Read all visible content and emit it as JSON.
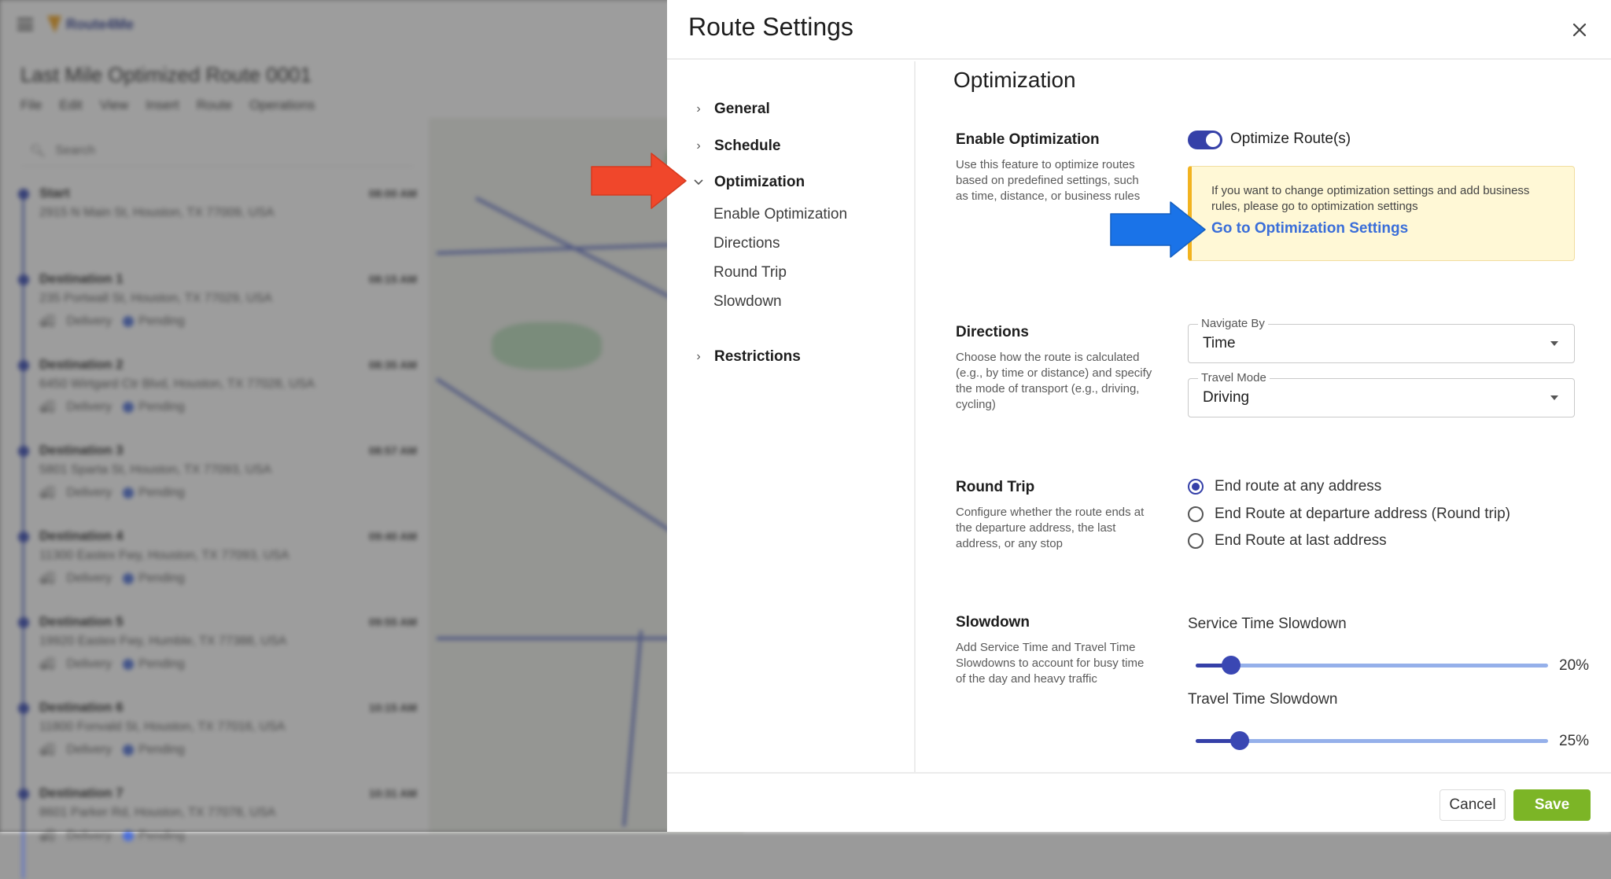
{
  "background_app": {
    "logo_text": "Route4Me",
    "route_title": "Last Mile Optimized Route 0001",
    "menu": [
      "File",
      "Edit",
      "View",
      "Insert",
      "Route",
      "Operations"
    ],
    "search_placeholder": "Search",
    "stops": [
      {
        "name": "Start",
        "time": "08:00 AM",
        "address": "2915 N Main St, Houston, TX 77009, USA",
        "type": "",
        "status": ""
      },
      {
        "name": "Destination 1",
        "time": "08:15 AM",
        "address": "235 Portwall St, Houston, TX 77029, USA",
        "type": "Delivery",
        "status": "Pending"
      },
      {
        "name": "Destination 2",
        "time": "08:35 AM",
        "address": "6450 Wirtgard Ctr Blvd, Houston, TX 77028, USA",
        "type": "Delivery",
        "status": "Pending"
      },
      {
        "name": "Destination 3",
        "time": "08:57 AM",
        "address": "5801 Sparta St, Houston, TX 77093, USA",
        "type": "Delivery",
        "status": "Pending"
      },
      {
        "name": "Destination 4",
        "time": "09:40 AM",
        "address": "11300 Eastex Fwy, Houston, TX 77093, USA",
        "type": "Delivery",
        "status": "Pending"
      },
      {
        "name": "Destination 5",
        "time": "09:55 AM",
        "address": "19920 Eastex Fwy, Humble, TX 77388, USA",
        "type": "Delivery",
        "status": "Pending"
      },
      {
        "name": "Destination 6",
        "time": "10:15 AM",
        "address": "11800 Fonvald St, Houston, TX 77016, USA",
        "type": "Delivery",
        "status": "Pending"
      },
      {
        "name": "Destination 7",
        "time": "10:31 AM",
        "address": "8601 Parker Rd, Houston, TX 77078, USA",
        "type": "Delivery",
        "status": "Pending"
      }
    ]
  },
  "drawer": {
    "title": "Route Settings",
    "close_icon": "close-icon",
    "nav": {
      "items": [
        {
          "label": "General",
          "expanded": false
        },
        {
          "label": "Schedule",
          "expanded": false
        },
        {
          "label": "Optimization",
          "expanded": true
        },
        {
          "label": "Restrictions",
          "expanded": false
        }
      ],
      "sub_items": [
        "Enable Optimization",
        "Directions",
        "Round Trip",
        "Slowdown"
      ]
    },
    "section_title": "Optimization",
    "enable_optimization": {
      "label": "Enable Optimization",
      "description": "Use this feature to optimize routes based on predefined settings, such as time, distance, or business rules",
      "toggle_label": "Optimize Route(s)",
      "toggle_on": true,
      "notice_text": "If you want to change optimization settings and add business rules, please go to optimization settings",
      "notice_link": "Go to Optimization Settings"
    },
    "directions": {
      "label": "Directions",
      "description": "Choose how the route is calculated (e.g., by time or distance) and specify the mode of transport (e.g., driving, cycling)",
      "navigate_by_label": "Navigate By",
      "navigate_by_value": "Time",
      "travel_mode_label": "Travel Mode",
      "travel_mode_value": "Driving"
    },
    "round_trip": {
      "label": "Round Trip",
      "description": "Configure whether the route ends at the departure address, the last address, or any stop",
      "options": [
        {
          "label": "End route at any address",
          "checked": true
        },
        {
          "label": "End Route at departure address (Round trip)",
          "checked": false
        },
        {
          "label": "End Route at last address",
          "checked": false
        }
      ]
    },
    "slowdown": {
      "label": "Slowdown",
      "description": "Add Service Time and Travel Time Slowdowns to account for busy time of the day and heavy traffic",
      "service_time_label": "Service Time Slowdown",
      "service_time_value": 20,
      "service_time_display": "20%",
      "travel_time_label": "Travel Time Slowdown",
      "travel_time_value": 25,
      "travel_time_display": "25%",
      "slider_max": 200
    },
    "footer": {
      "cancel_label": "Cancel",
      "save_label": "Save"
    }
  },
  "colors": {
    "accent": "#3540a8",
    "link": "#3a6ed9",
    "save": "#7cb526",
    "notice_bg": "#fff8d6",
    "notice_border": "#f2b320",
    "annotation_red": "#f0472b",
    "annotation_blue": "#1a73e8"
  }
}
